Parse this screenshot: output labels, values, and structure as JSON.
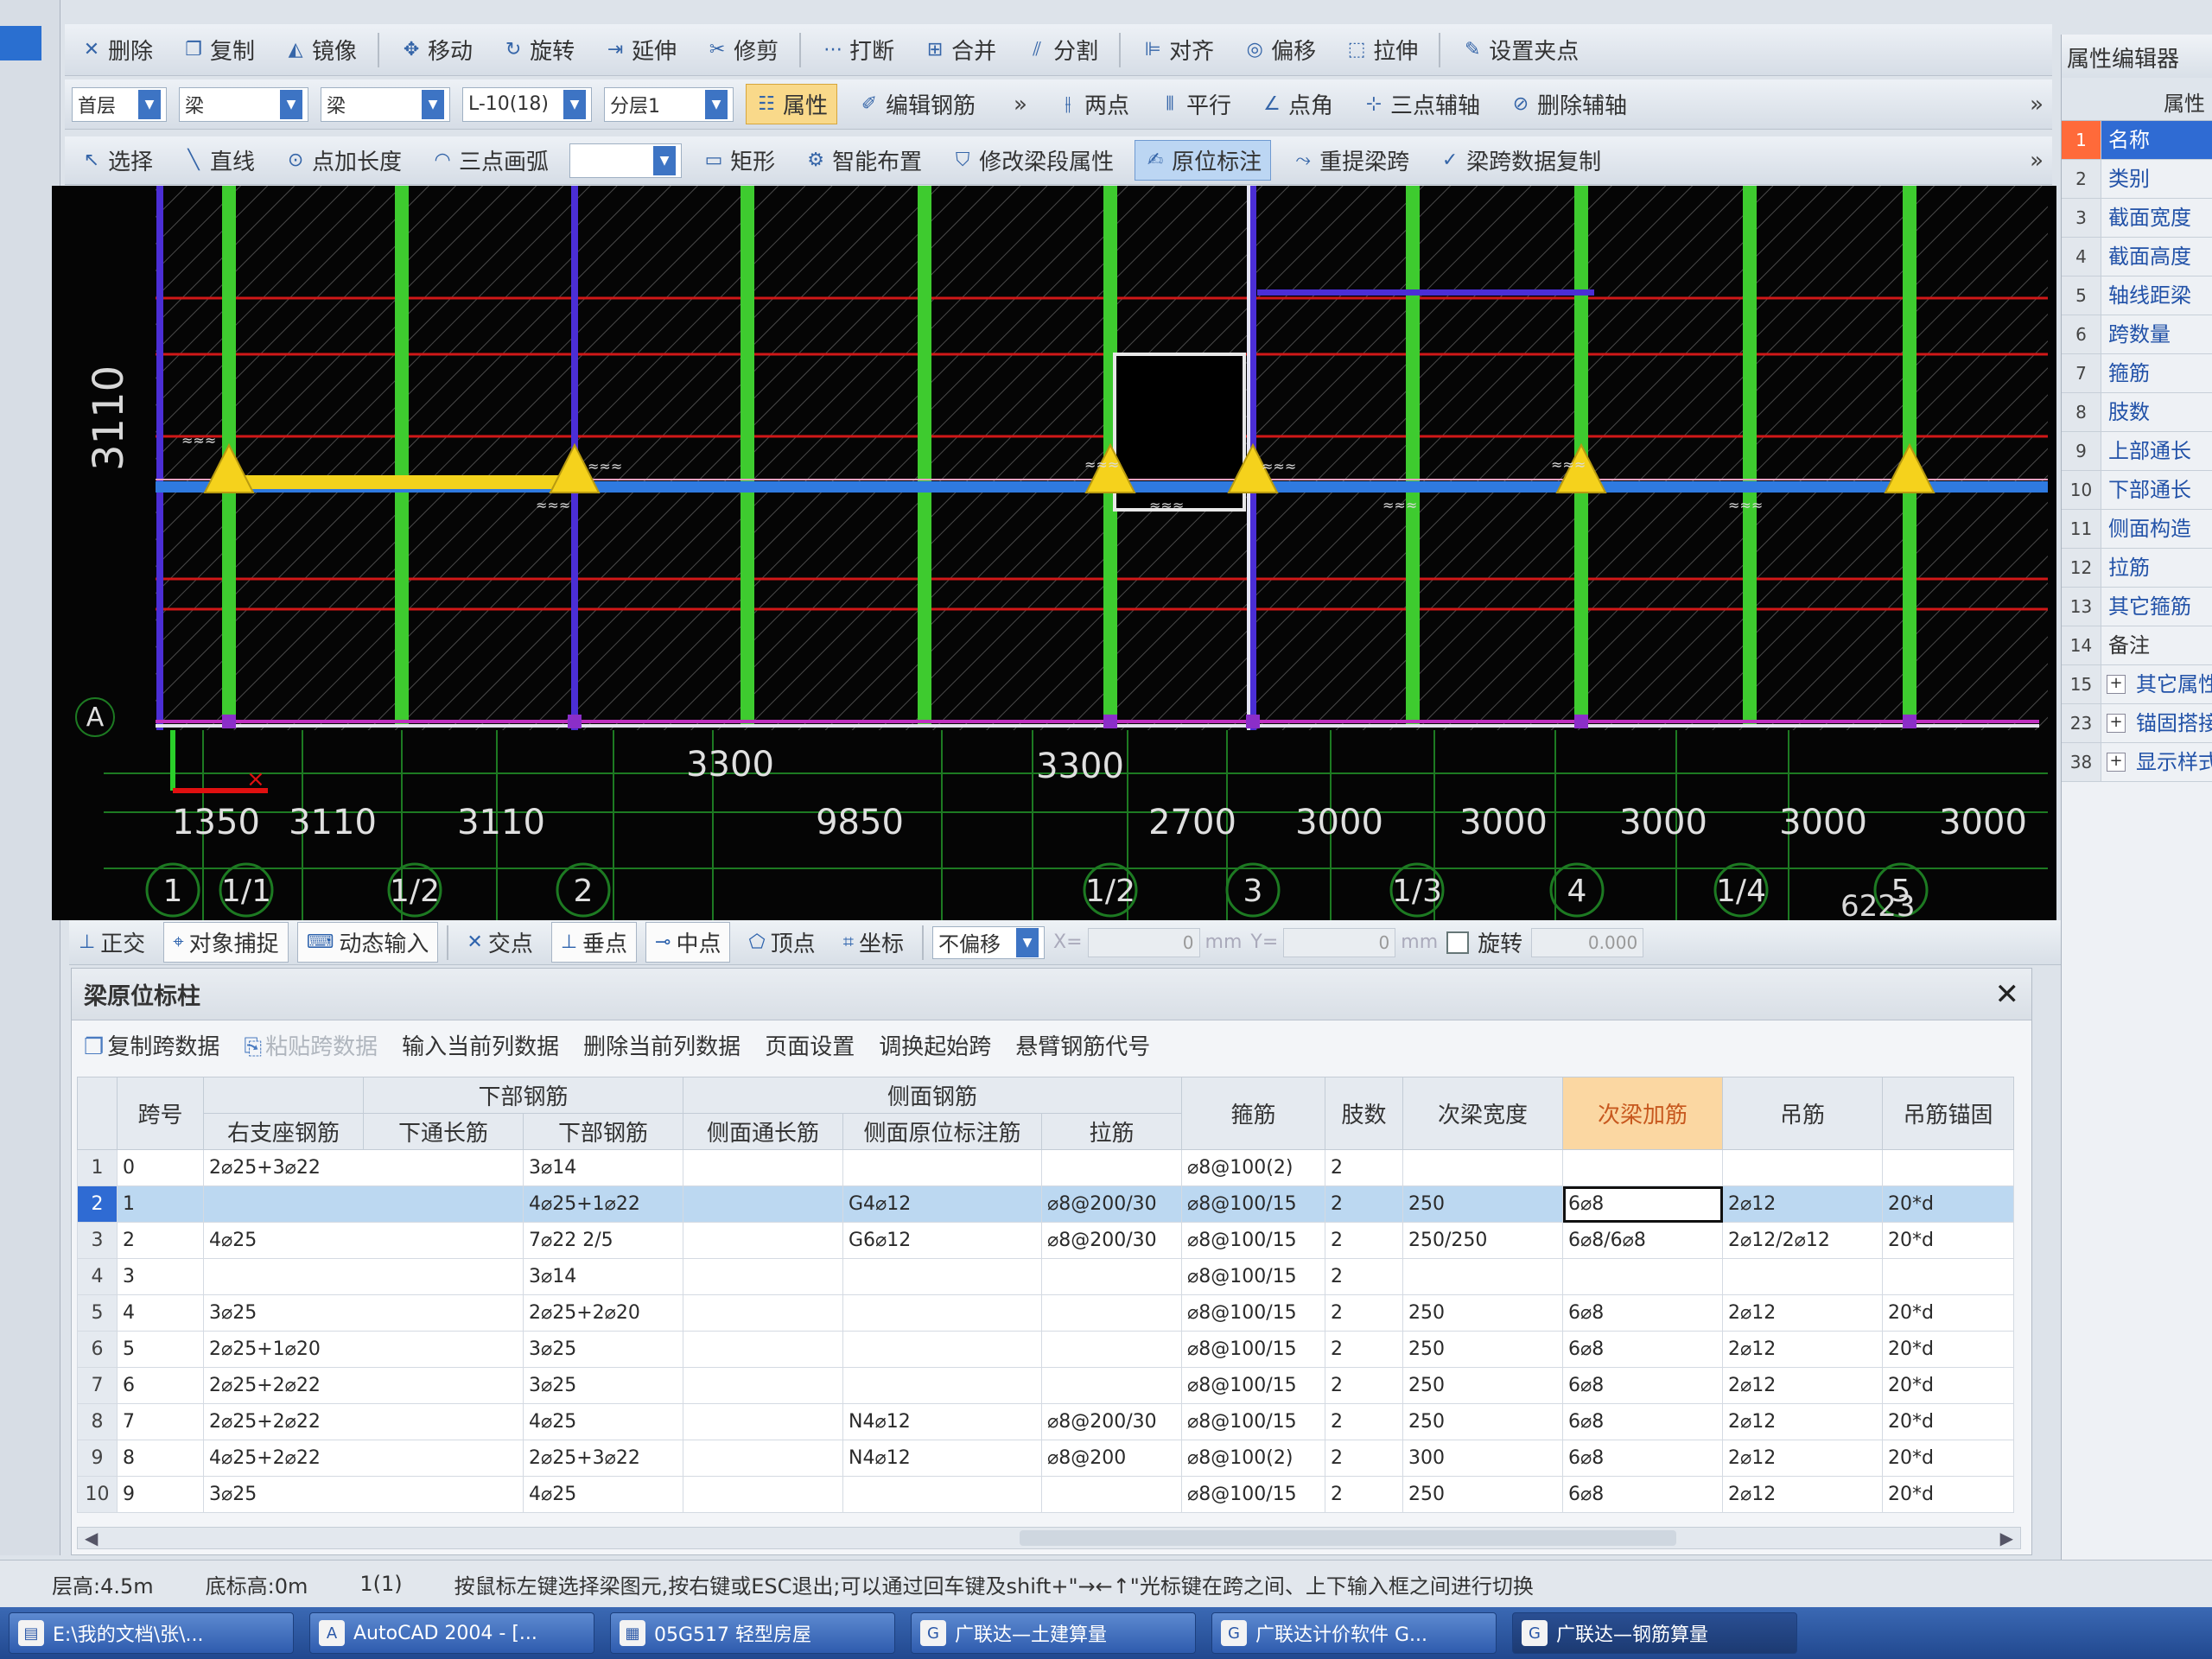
{
  "toolbar1": [
    {
      "icon": "delete-icon",
      "glyph": "✕",
      "label": "删除"
    },
    {
      "icon": "copy-icon",
      "glyph": "❐",
      "label": "复制"
    },
    {
      "icon": "mirror-icon",
      "glyph": "◭",
      "label": "镜像"
    },
    {
      "icon": "move-icon",
      "glyph": "✥",
      "label": "移动"
    },
    {
      "icon": "rotate-icon",
      "glyph": "↻",
      "label": "旋转"
    },
    {
      "icon": "extend-icon",
      "glyph": "⇥",
      "label": "延伸"
    },
    {
      "icon": "trim-icon",
      "glyph": "✂",
      "label": "修剪"
    },
    {
      "icon": "break-icon",
      "glyph": "⋯",
      "label": "打断"
    },
    {
      "icon": "merge-icon",
      "glyph": "⊞",
      "label": "合并"
    },
    {
      "icon": "split-icon",
      "glyph": "⫽",
      "label": "分割"
    },
    {
      "icon": "align-icon",
      "glyph": "⊫",
      "label": "对齐"
    },
    {
      "icon": "offset-icon",
      "glyph": "◎",
      "label": "偏移"
    },
    {
      "icon": "stretch-icon",
      "glyph": "⬚",
      "label": "拉伸"
    },
    {
      "icon": "grip-icon",
      "glyph": "✎",
      "label": "设置夹点"
    }
  ],
  "toolbar2": {
    "combos": [
      {
        "value": "首层"
      },
      {
        "value": "梁"
      },
      {
        "value": "梁"
      },
      {
        "value": "L-10(18)"
      },
      {
        "value": "分层1"
      }
    ],
    "buttons": [
      {
        "icon": "property-icon",
        "glyph": "☷",
        "label": "属性"
      },
      {
        "icon": "edit-rebar-icon",
        "glyph": "✐",
        "label": "编辑钢筋"
      },
      {
        "icon": "two-point-icon",
        "glyph": "⫲",
        "label": "两点"
      },
      {
        "icon": "parallel-icon",
        "glyph": "⫴",
        "label": "平行"
      },
      {
        "icon": "point-angle-icon",
        "glyph": "∠",
        "label": "点角"
      },
      {
        "icon": "three-point-axis-icon",
        "glyph": "⊹",
        "label": "三点辅轴"
      },
      {
        "icon": "delete-axis-icon",
        "glyph": "⊘",
        "label": "删除辅轴"
      }
    ]
  },
  "toolbar3": [
    {
      "icon": "select-icon",
      "glyph": "↖",
      "label": "选择"
    },
    {
      "icon": "line-icon",
      "glyph": "╲",
      "label": "直线"
    },
    {
      "icon": "point-length-icon",
      "glyph": "⊙",
      "label": "点加长度"
    },
    {
      "icon": "arc-icon",
      "glyph": "◠",
      "label": "三点画弧"
    },
    {
      "icon": "rect-icon",
      "glyph": "▭",
      "label": "矩形"
    },
    {
      "icon": "smart-layout-icon",
      "glyph": "⚙",
      "label": "智能布置"
    },
    {
      "icon": "modify-span-icon",
      "glyph": "⛉",
      "label": "修改梁段属性"
    },
    {
      "icon": "original-mark-icon",
      "glyph": "✍",
      "label": "原位标注"
    },
    {
      "icon": "reextract-span-icon",
      "glyph": "⤳",
      "label": "重提梁跨"
    },
    {
      "icon": "span-copy-icon",
      "glyph": "✓",
      "label": "梁跨数据复制"
    }
  ],
  "canvas": {
    "dims_top": [
      "3300",
      "3300"
    ],
    "dims_bottom": [
      "1350",
      "3110",
      "3110",
      "9850",
      "2700",
      "3000",
      "3000",
      "3000",
      "3000",
      "3000"
    ],
    "axes": [
      "1",
      "1/1",
      "1/2",
      "2",
      "1/2",
      "3",
      "1/3",
      "4",
      "1/4",
      "5"
    ],
    "side_label": "3110",
    "row_label": "A",
    "corner_text": "6223"
  },
  "snap_bar": {
    "buttons": [
      {
        "label": "正交",
        "icon": "ortho-icon",
        "glyph": "⊥",
        "on": false
      },
      {
        "label": "对象捕捉",
        "icon": "object-snap-icon",
        "glyph": "⌖",
        "on": true
      },
      {
        "label": "动态输入",
        "icon": "dynamic-input-icon",
        "glyph": "⌨",
        "on": true
      },
      {
        "label": "交点",
        "icon": "intersection-icon",
        "glyph": "✕",
        "on": false
      },
      {
        "label": "垂点",
        "icon": "perpendicular-icon",
        "glyph": "⊥",
        "on": true
      },
      {
        "label": "中点",
        "icon": "midpoint-icon",
        "glyph": "⊸",
        "on": true
      },
      {
        "label": "顶点",
        "icon": "vertex-icon",
        "glyph": "⬠",
        "on": false
      },
      {
        "label": "坐标",
        "icon": "coordinate-icon",
        "glyph": "⌗",
        "on": false
      }
    ],
    "offset_value": "不偏移",
    "x_label": "X=",
    "x_value": "0",
    "y_label": "Y=",
    "y_value": "0",
    "unit": "mm",
    "rotate_label": "旋转",
    "rotate_value": "0.000"
  },
  "property_panel": {
    "title": "属性编辑器",
    "header": "属性",
    "rows": [
      {
        "num": "1",
        "label": "名称",
        "selected": true
      },
      {
        "num": "2",
        "label": "类别"
      },
      {
        "num": "3",
        "label": "截面宽度"
      },
      {
        "num": "4",
        "label": "截面高度"
      },
      {
        "num": "5",
        "label": "轴线距梁"
      },
      {
        "num": "6",
        "label": "跨数量"
      },
      {
        "num": "7",
        "label": "箍筋"
      },
      {
        "num": "8",
        "label": "肢数"
      },
      {
        "num": "9",
        "label": "上部通长"
      },
      {
        "num": "10",
        "label": "下部通长"
      },
      {
        "num": "11",
        "label": "侧面构造"
      },
      {
        "num": "12",
        "label": "拉筋"
      },
      {
        "num": "13",
        "label": "其它箍筋"
      },
      {
        "num": "14",
        "label": "备注",
        "plain": true
      },
      {
        "num": "15",
        "label": "其它属性",
        "plus": true
      },
      {
        "num": "23",
        "label": "锚固搭接",
        "plus": true
      },
      {
        "num": "38",
        "label": "显示样式",
        "plus": true
      }
    ]
  },
  "panel": {
    "title": "梁原位标柱",
    "tools": [
      {
        "label": "复制跨数据",
        "disabled": false,
        "icon": "copy-span-icon",
        "glyph": "❐"
      },
      {
        "label": "粘贴跨数据",
        "disabled": true,
        "icon": "paste-span-icon",
        "glyph": "⎘"
      },
      {
        "label": "输入当前列数据",
        "disabled": false
      },
      {
        "label": "删除当前列数据",
        "disabled": false
      },
      {
        "label": "页面设置",
        "disabled": false
      },
      {
        "label": "调换起始跨",
        "disabled": false
      },
      {
        "label": "悬臂钢筋代号",
        "disabled": false
      }
    ],
    "group_headers": {
      "bottom": "下部钢筋",
      "side": "侧面钢筋"
    },
    "columns": {
      "span": "跨号",
      "right_support": "右支座钢筋",
      "bottom_through": "下通长筋",
      "bottom_rebar": "下部钢筋",
      "side_through": "侧面通长筋",
      "side_mark": "侧面原位标注筋",
      "tie": "拉筋",
      "stirrup": "箍筋",
      "legs": "肢数",
      "sec_width": "次梁宽度",
      "sec_add": "次梁加筋",
      "hanger": "吊筋",
      "hanger_anchor": "吊筋锚固"
    },
    "rows": [
      {
        "n": "1",
        "span": "0",
        "right_support": "2⌀25+3⌀22",
        "bottom_through": "",
        "bottom_rebar": "3⌀14",
        "side_through": "",
        "side_mark": "",
        "tie": "",
        "stirrup": "⌀8@100(2)",
        "legs": "2",
        "sec_width": "",
        "sec_add": "",
        "hanger": "",
        "hanger_anchor": ""
      },
      {
        "n": "2",
        "span": "1",
        "right_support": "",
        "bottom_through": "",
        "bottom_rebar": "4⌀25+1⌀22",
        "side_through": "",
        "side_mark": "G4⌀12",
        "tie": "⌀8@200/30",
        "stirrup": "⌀8@100/15",
        "legs": "2",
        "sec_width": "250",
        "sec_add": "6⌀8",
        "hanger": "2⌀12",
        "hanger_anchor": "20*d",
        "selected": true
      },
      {
        "n": "3",
        "span": "2",
        "right_support": "4⌀25",
        "bottom_through": "",
        "bottom_rebar": "7⌀22 2/5",
        "side_through": "",
        "side_mark": "G6⌀12",
        "tie": "⌀8@200/30",
        "stirrup": "⌀8@100/15",
        "legs": "2",
        "sec_width": "250/250",
        "sec_add": "6⌀8/6⌀8",
        "hanger": "2⌀12/2⌀12",
        "hanger_anchor": "20*d"
      },
      {
        "n": "4",
        "span": "3",
        "right_support": "",
        "bottom_through": "",
        "bottom_rebar": "3⌀14",
        "side_through": "",
        "side_mark": "",
        "tie": "",
        "stirrup": "⌀8@100/15",
        "legs": "2",
        "sec_width": "",
        "sec_add": "",
        "hanger": "",
        "hanger_anchor": ""
      },
      {
        "n": "5",
        "span": "4",
        "right_support": "3⌀25",
        "bottom_through": "",
        "bottom_rebar": "2⌀25+2⌀20",
        "side_through": "",
        "side_mark": "",
        "tie": "",
        "stirrup": "⌀8@100/15",
        "legs": "2",
        "sec_width": "250",
        "sec_add": "6⌀8",
        "hanger": "2⌀12",
        "hanger_anchor": "20*d"
      },
      {
        "n": "6",
        "span": "5",
        "right_support": "2⌀25+1⌀20",
        "bottom_through": "",
        "bottom_rebar": "3⌀25",
        "side_through": "",
        "side_mark": "",
        "tie": "",
        "stirrup": "⌀8@100/15",
        "legs": "2",
        "sec_width": "250",
        "sec_add": "6⌀8",
        "hanger": "2⌀12",
        "hanger_anchor": "20*d"
      },
      {
        "n": "7",
        "span": "6",
        "right_support": "2⌀25+2⌀22",
        "bottom_through": "",
        "bottom_rebar": "3⌀25",
        "side_through": "",
        "side_mark": "",
        "tie": "",
        "stirrup": "⌀8@100/15",
        "legs": "2",
        "sec_width": "250",
        "sec_add": "6⌀8",
        "hanger": "2⌀12",
        "hanger_anchor": "20*d"
      },
      {
        "n": "8",
        "span": "7",
        "right_support": "2⌀25+2⌀22",
        "bottom_through": "",
        "bottom_rebar": "4⌀25",
        "side_through": "",
        "side_mark": "N4⌀12",
        "tie": "⌀8@200/30",
        "stirrup": "⌀8@100/15",
        "legs": "2",
        "sec_width": "250",
        "sec_add": "6⌀8",
        "hanger": "2⌀12",
        "hanger_anchor": "20*d"
      },
      {
        "n": "9",
        "span": "8",
        "right_support": "4⌀25+2⌀22",
        "bottom_through": "",
        "bottom_rebar": "2⌀25+3⌀22",
        "side_through": "",
        "side_mark": "N4⌀12",
        "tie": "⌀8@200",
        "stirrup": "⌀8@100(2)",
        "legs": "2",
        "sec_width": "300",
        "sec_add": "6⌀8",
        "hanger": "2⌀12",
        "hanger_anchor": "20*d"
      },
      {
        "n": "10",
        "span": "9",
        "right_support": "3⌀25",
        "bottom_through": "",
        "bottom_rebar": "4⌀25",
        "side_through": "",
        "side_mark": "",
        "tie": "",
        "stirrup": "⌀8@100/15",
        "legs": "2",
        "sec_width": "250",
        "sec_add": "6⌀8",
        "hanger": "2⌀12",
        "hanger_anchor": "20*d"
      }
    ]
  },
  "status": {
    "floor_height": "层高:4.5m",
    "bottom_elev": "底标高:0m",
    "count": "1(1)",
    "hint": "按鼠标左键选择梁图元,按右键或ESC退出;可以通过回车键及shift+\"→←↑\"光标键在跨之间、上下输入框之间进行切换"
  },
  "taskbar": [
    {
      "label": "E:\\我的文档\\张\\...",
      "icon": "folder-icon",
      "glyph": "▤"
    },
    {
      "label": "AutoCAD 2004 - [...",
      "icon": "autocad-icon",
      "glyph": "A"
    },
    {
      "label": "05G517 轻型房屋",
      "icon": "pdf-icon",
      "glyph": "▦"
    },
    {
      "label": "广联达—土建算量",
      "icon": "gld-civil-icon",
      "glyph": "G"
    },
    {
      "label": "广联达计价软件 G...",
      "icon": "gld-price-icon",
      "glyph": "G"
    },
    {
      "label": "广联达—钢筋算量",
      "icon": "gld-rebar-icon",
      "glyph": "G",
      "active": true
    }
  ]
}
